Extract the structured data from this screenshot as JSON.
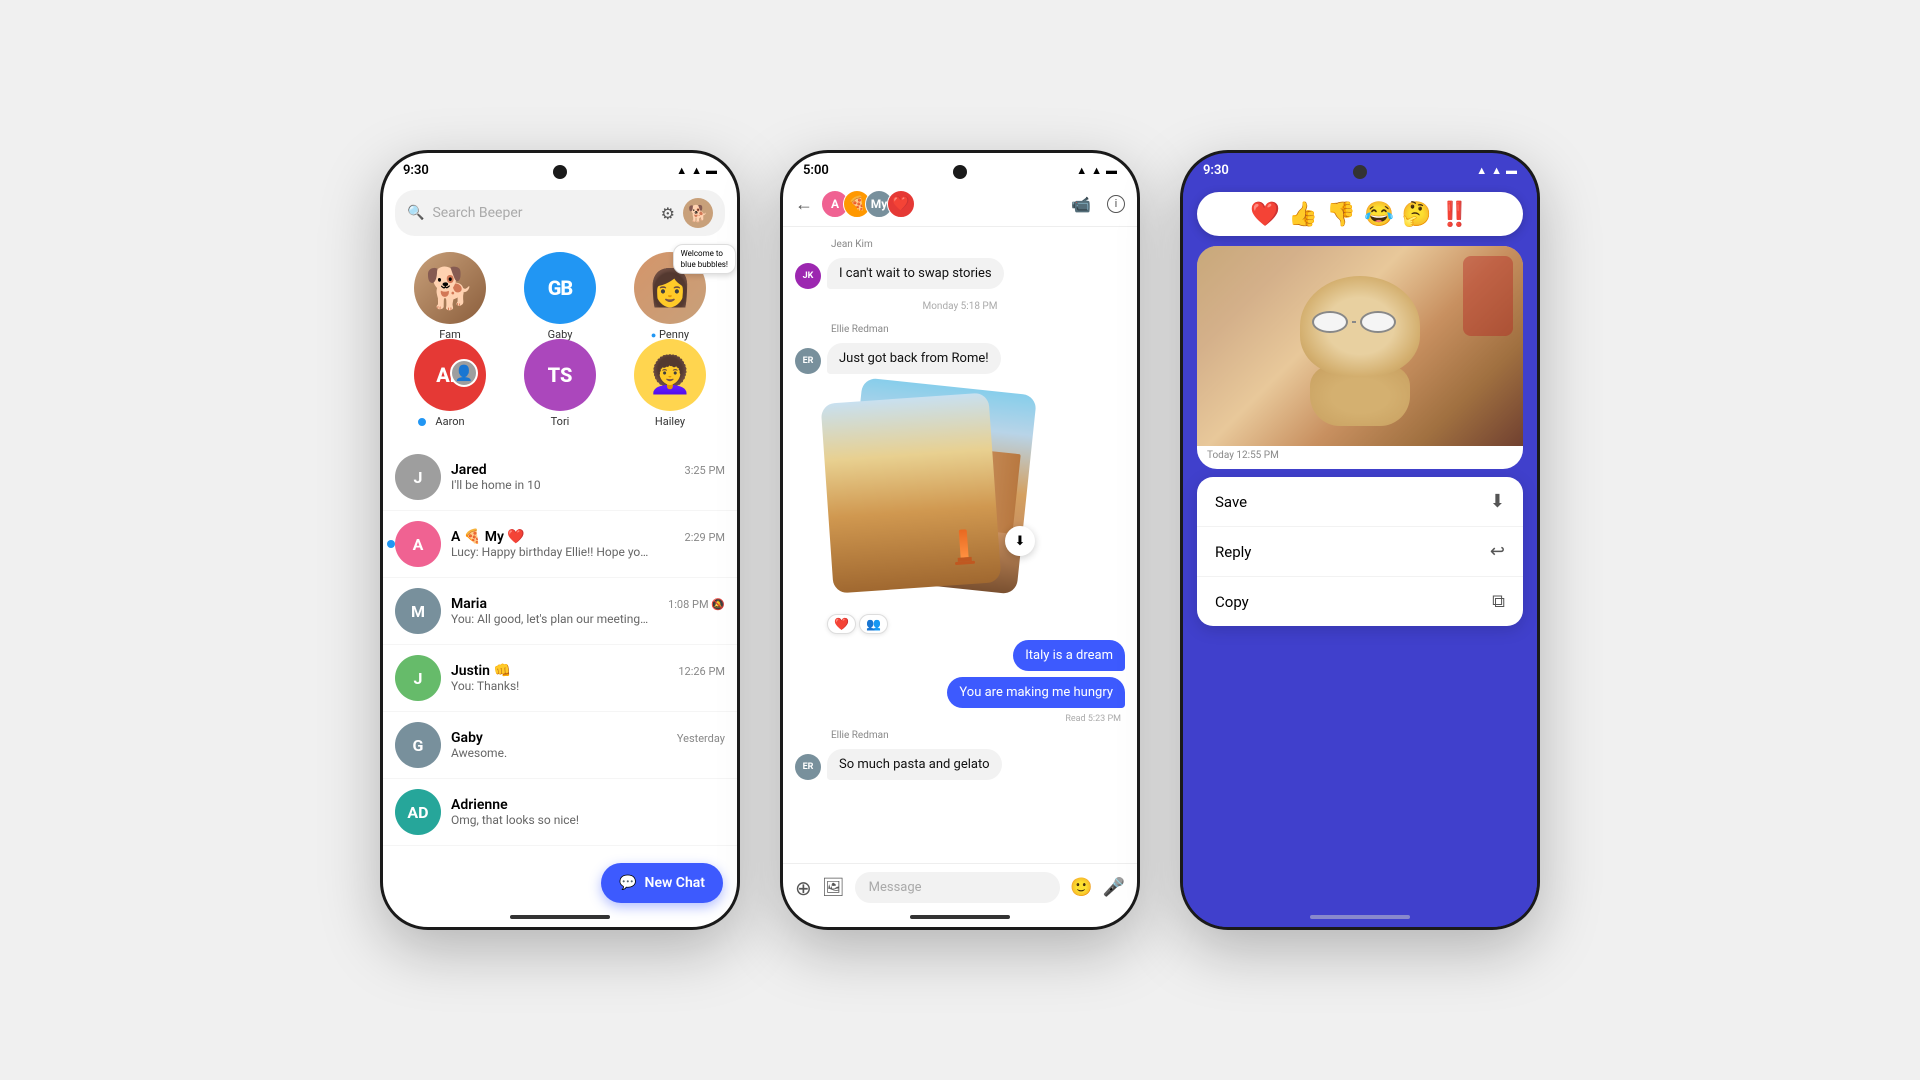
{
  "phone1": {
    "status_time": "9:30",
    "search_placeholder": "Search Beeper",
    "stories": [
      {
        "id": "fam",
        "label": "Fam",
        "initials": "🐕",
        "color": "#c8a07a",
        "type": "dog"
      },
      {
        "id": "gaby",
        "label": "Gaby",
        "initials": "GB",
        "color": "#2196F3"
      },
      {
        "id": "penny",
        "label": "Penny",
        "initials": "",
        "color": "#e8c5a0",
        "type": "photo",
        "online": true,
        "tooltip": "Welcome to\nblue bubbles!"
      }
    ],
    "stories2": [
      {
        "id": "aaron",
        "label": "Aaron",
        "initials": "AN",
        "color": "#e53935",
        "online": true
      },
      {
        "id": "tori",
        "label": "Tori",
        "initials": "TS",
        "color": "#ab47bc"
      },
      {
        "id": "hailey",
        "label": "Hailey",
        "initials": "",
        "color": "#ffd54f",
        "type": "photo"
      }
    ],
    "chats": [
      {
        "id": "jared",
        "name": "Jared",
        "preview": "I'll be home in 10",
        "time": "3:25 PM",
        "initials": "J",
        "color": "#9e9e9e",
        "unread": false
      },
      {
        "id": "amy",
        "name": "A 🍕 My ❤️",
        "preview": "Lucy: Happy birthday Ellie!! Hope you've had a lovely day 🙂",
        "time": "2:29 PM",
        "initials": "A",
        "color": "#f06292",
        "unread": true
      },
      {
        "id": "maria",
        "name": "Maria",
        "preview": "You: All good, let's plan our meeting cool?",
        "time": "1:08 PM",
        "initials": "M",
        "color": "#78909c",
        "muted": true
      },
      {
        "id": "justin",
        "name": "Justin 👊",
        "preview": "You: Thanks!",
        "time": "12:26 PM",
        "initials": "J",
        "color": "#66bb6a"
      },
      {
        "id": "gaby2",
        "name": "Gaby",
        "preview": "Awesome.",
        "time": "Yesterday",
        "initials": "G",
        "color": "#78909c"
      },
      {
        "id": "adrienne",
        "name": "Adrienne",
        "preview": "Omg, that looks so nice!",
        "time": "",
        "initials": "AD",
        "color": "#26a69a"
      }
    ],
    "new_chat_label": "New Chat"
  },
  "phone2": {
    "status_time": "5:00",
    "chat_name": "A 🍕 My ❤️",
    "messages": [
      {
        "id": "m1",
        "sender": "Jean Kim",
        "text": "I can't wait to swap stories",
        "type": "incoming"
      },
      {
        "id": "m2",
        "date": "Monday 5:18 PM"
      },
      {
        "id": "m3",
        "sender": "Ellie Redman",
        "text": "Just got back from Rome!",
        "type": "incoming"
      },
      {
        "id": "m4",
        "type": "image_group"
      },
      {
        "id": "m5",
        "text": "Italy is a dream",
        "type": "outgoing"
      },
      {
        "id": "m6",
        "text": "You are making me hungry",
        "type": "outgoing"
      },
      {
        "id": "m7",
        "read": "Read 5:23 PM"
      },
      {
        "id": "m8",
        "sender": "Ellie Redman",
        "text": "So much pasta and gelato",
        "type": "incoming"
      }
    ],
    "reactions": [
      "❤️",
      "👥"
    ],
    "message_placeholder": "Message"
  },
  "phone3": {
    "status_time": "9:30",
    "emojis": [
      "❤️",
      "👍",
      "👎",
      "😂",
      "🤔",
      "‼️"
    ],
    "image_timestamp": "Today  12:55 PM",
    "menu_items": [
      {
        "id": "save",
        "label": "Save",
        "icon": "⬇"
      },
      {
        "id": "reply",
        "label": "Reply",
        "icon": "↩"
      },
      {
        "id": "copy",
        "label": "Copy",
        "icon": "⧉"
      }
    ]
  },
  "icons": {
    "search": "🔍",
    "gear": "⚙",
    "back": "←",
    "video": "📹",
    "info": "ℹ",
    "plus": "+",
    "sticker": "🖼",
    "emoji": "🙂",
    "mic": "🎤",
    "chat_bubble": "💬",
    "download": "⬇"
  }
}
